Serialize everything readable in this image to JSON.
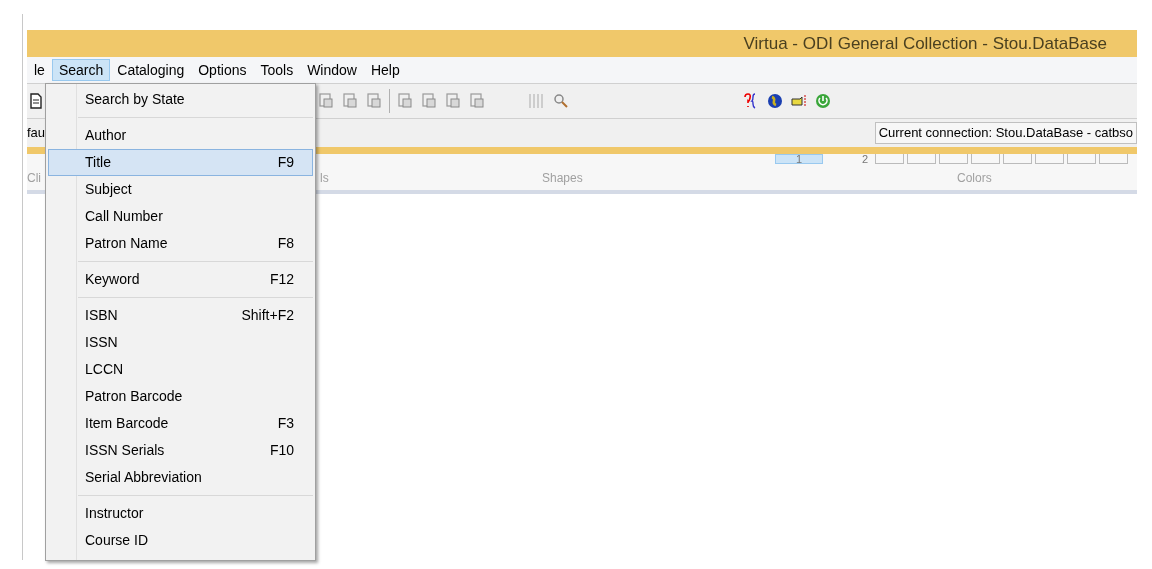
{
  "window": {
    "title": "Virtua - ODI General Collection - Stou.DataBase"
  },
  "menu_bar": [
    {
      "label": "le",
      "selected": false
    },
    {
      "label": "Search",
      "selected": true
    },
    {
      "label": "Cataloging",
      "selected": false
    },
    {
      "label": "Options",
      "selected": false
    },
    {
      "label": "Tools",
      "selected": false
    },
    {
      "label": "Window",
      "selected": false
    },
    {
      "label": "Help",
      "selected": false
    }
  ],
  "status_row": {
    "left_text": "fau",
    "connection": "Current connection: Stou.DataBase - catbso"
  },
  "ribbon": {
    "group_labels": [
      "Cli",
      "ls",
      "Shapes",
      "Colors"
    ],
    "color_tabs": [
      {
        "label": "1",
        "selected": true
      },
      {
        "label": "2",
        "selected": false
      }
    ]
  },
  "search_menu": [
    {
      "kind": "item",
      "label": "Search by State",
      "selected": false
    },
    {
      "kind": "separator"
    },
    {
      "kind": "item",
      "label": "Author",
      "selected": false
    },
    {
      "kind": "item",
      "label": "Title",
      "shortcut": "F9",
      "selected": true
    },
    {
      "kind": "item",
      "label": "Subject",
      "selected": false
    },
    {
      "kind": "item",
      "label": "Call Number",
      "selected": false
    },
    {
      "kind": "item",
      "label": "Patron Name",
      "shortcut": "F8",
      "selected": false
    },
    {
      "kind": "separator"
    },
    {
      "kind": "item",
      "label": "Keyword",
      "shortcut": "F12",
      "selected": false
    },
    {
      "kind": "separator"
    },
    {
      "kind": "item",
      "label": "ISBN",
      "shortcut": "Shift+F2",
      "selected": false
    },
    {
      "kind": "item",
      "label": "ISSN",
      "selected": false
    },
    {
      "kind": "item",
      "label": "LCCN",
      "selected": false
    },
    {
      "kind": "item",
      "label": "Patron Barcode",
      "selected": false
    },
    {
      "kind": "item",
      "label": "Item Barcode",
      "shortcut": "F3",
      "selected": false
    },
    {
      "kind": "item",
      "label": "ISSN Serials",
      "shortcut": "F10",
      "selected": false
    },
    {
      "kind": "item",
      "label": "Serial Abbreviation",
      "selected": false
    },
    {
      "kind": "separator"
    },
    {
      "kind": "item",
      "label": "Instructor",
      "selected": false
    },
    {
      "kind": "item",
      "label": "Course ID",
      "selected": false
    }
  ]
}
